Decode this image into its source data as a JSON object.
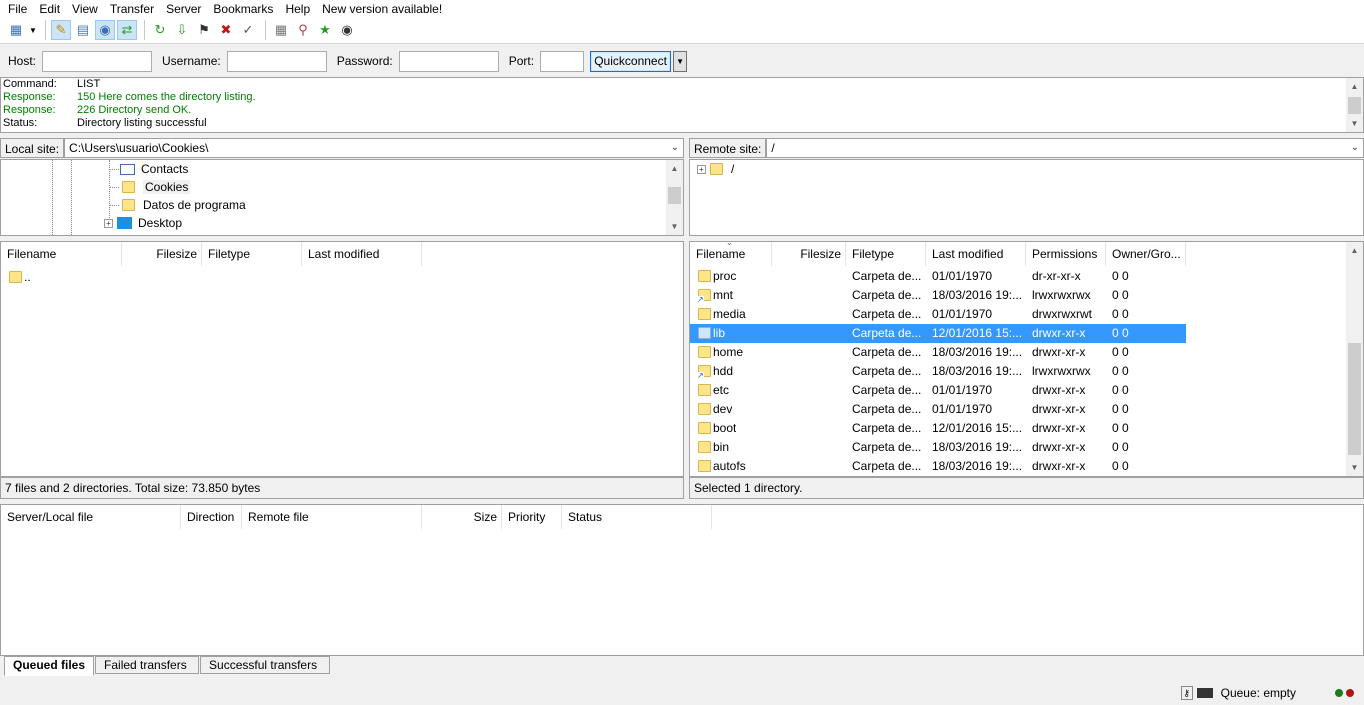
{
  "menu": [
    "File",
    "Edit",
    "View",
    "Transfer",
    "Server",
    "Bookmarks",
    "Help",
    "New version available!"
  ],
  "toolbar_icons": [
    "site-manager-icon",
    "dropdown-arrow-icon",
    "toggle-log-icon",
    "toggle-local-tree-icon",
    "toggle-remote-tree-icon",
    "toggle-queue-icon",
    "refresh-icon",
    "process-queue-icon",
    "cancel-icon",
    "disconnect-icon",
    "reconnect-icon",
    "directory-compare-icon",
    "sync-browse-icon",
    "filter-icon",
    "search-icon"
  ],
  "quickconnect": {
    "host_label": "Host:",
    "host_value": "",
    "username_label": "Username:",
    "username_value": "",
    "password_label": "Password:",
    "password_value": "",
    "port_label": "Port:",
    "port_value": "",
    "button_label": "Quickconnect"
  },
  "log": [
    {
      "key": "Command:",
      "text": "LIST",
      "color": "#000000"
    },
    {
      "key": "Response:",
      "text": "150 Here comes the directory listing.",
      "color": "#008000"
    },
    {
      "key": "Response:",
      "text": "226 Directory send OK.",
      "color": "#008000"
    },
    {
      "key": "Status:",
      "text": "Directory listing successful",
      "color": "#000000"
    }
  ],
  "local": {
    "site_label": "Local site:",
    "path": "C:\\Users\\usuario\\Cookies\\",
    "tree": [
      "Contacts",
      "Cookies",
      "Datos de programa",
      "Desktop"
    ],
    "headers": [
      "Filename",
      "Filesize",
      "Filetype",
      "Last modified"
    ],
    "files": [
      ".."
    ],
    "status": "7 files and 2 directories. Total size: 73.850 bytes"
  },
  "remote": {
    "site_label": "Remote site:",
    "path": "/",
    "tree_root": "/",
    "headers": [
      "Filename",
      "Filesize",
      "Filetype",
      "Last modified",
      "Permissions",
      "Owner/Gro..."
    ],
    "files": [
      {
        "name": "proc",
        "type": "Carpeta de...",
        "modified": "01/01/1970",
        "perms": "dr-xr-xr-x",
        "owner": "0 0",
        "link": false
      },
      {
        "name": "mnt",
        "type": "Carpeta de...",
        "modified": "18/03/2016 19:...",
        "perms": "lrwxrwxrwx",
        "owner": "0 0",
        "link": true
      },
      {
        "name": "media",
        "type": "Carpeta de...",
        "modified": "01/01/1970",
        "perms": "drwxrwxrwt",
        "owner": "0 0",
        "link": false
      },
      {
        "name": "lib",
        "type": "Carpeta de...",
        "modified": "12/01/2016 15:...",
        "perms": "drwxr-xr-x",
        "owner": "0 0",
        "link": false
      },
      {
        "name": "home",
        "type": "Carpeta de...",
        "modified": "18/03/2016 19:...",
        "perms": "drwxr-xr-x",
        "owner": "0 0",
        "link": false
      },
      {
        "name": "hdd",
        "type": "Carpeta de...",
        "modified": "18/03/2016 19:...",
        "perms": "lrwxrwxrwx",
        "owner": "0 0",
        "link": true
      },
      {
        "name": "etc",
        "type": "Carpeta de...",
        "modified": "01/01/1970",
        "perms": "drwxr-xr-x",
        "owner": "0 0",
        "link": false
      },
      {
        "name": "dev",
        "type": "Carpeta de...",
        "modified": "01/01/1970",
        "perms": "drwxr-xr-x",
        "owner": "0 0",
        "link": false
      },
      {
        "name": "boot",
        "type": "Carpeta de...",
        "modified": "12/01/2016 15:...",
        "perms": "drwxr-xr-x",
        "owner": "0 0",
        "link": false
      },
      {
        "name": "bin",
        "type": "Carpeta de...",
        "modified": "18/03/2016 19:...",
        "perms": "drwxr-xr-x",
        "owner": "0 0",
        "link": false
      },
      {
        "name": "autofs",
        "type": "Carpeta de...",
        "modified": "18/03/2016 19:...",
        "perms": "drwxr-xr-x",
        "owner": "0 0",
        "link": false
      }
    ],
    "selected": "lib",
    "status": "Selected 1 directory."
  },
  "queue": {
    "headers": [
      "Server/Local file",
      "Direction",
      "Remote file",
      "Size",
      "Priority",
      "Status"
    ],
    "tabs": [
      "Queued files",
      "Failed transfers",
      "Successful transfers"
    ],
    "status_text": "Queue: empty"
  },
  "colors": {
    "selection": "#3399ff",
    "log_green": "#008000",
    "led_green": "#1e7b1e",
    "led_red": "#b01414"
  }
}
